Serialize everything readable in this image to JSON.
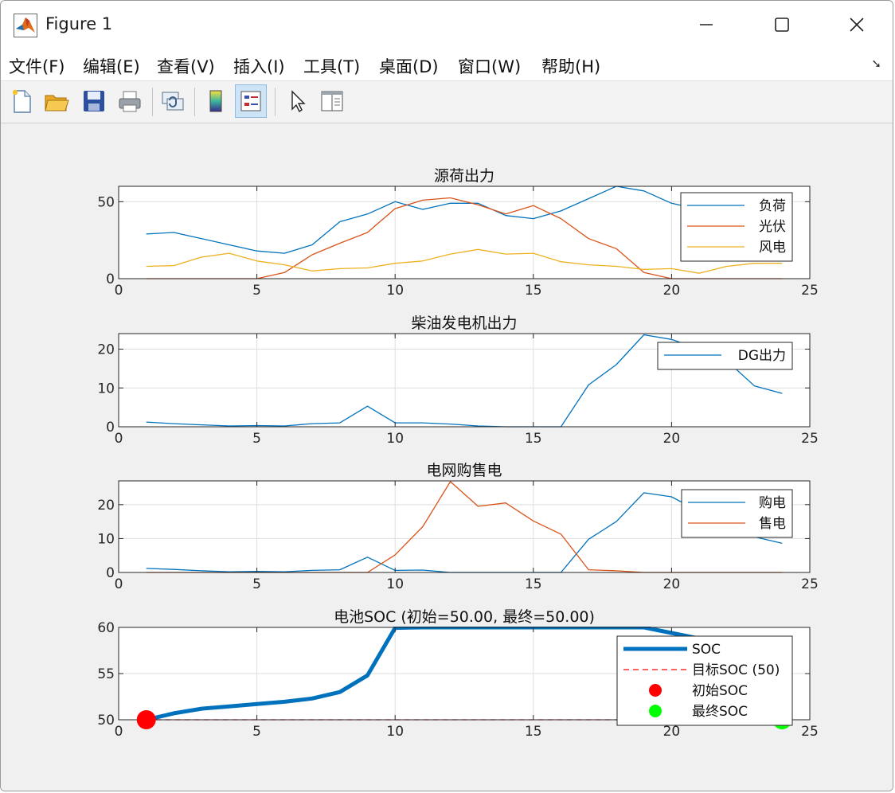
{
  "window": {
    "title": "Figure 1"
  },
  "menu": [
    "文件(F)",
    "编辑(E)",
    "查看(V)",
    "插入(I)",
    "工具(T)",
    "桌面(D)",
    "窗口(W)",
    "帮助(H)"
  ],
  "toolbar_icons": [
    "new-file-icon",
    "open-folder-icon",
    "save-icon",
    "print-icon",
    "link-plot-icon",
    "colorbar-icon",
    "legend-icon",
    "pointer-icon",
    "property-inspector-icon"
  ],
  "colors": {
    "blue": "#0072BD",
    "orange": "#D95319",
    "yellow": "#EDB120",
    "red": "#FF0000",
    "green": "#00FF00"
  },
  "chart_data": [
    {
      "type": "line",
      "title": "源荷出力",
      "xlim": [
        0,
        25
      ],
      "ylim": [
        0,
        60
      ],
      "xticks": [
        0,
        5,
        10,
        15,
        20,
        25
      ],
      "yticks": [
        0,
        50
      ],
      "x": [
        1,
        2,
        3,
        4,
        5,
        6,
        7,
        8,
        9,
        10,
        11,
        12,
        13,
        14,
        15,
        16,
        17,
        18,
        19,
        20,
        21,
        22,
        23,
        24
      ],
      "series": [
        {
          "name": "负荷",
          "color": "#0072BD",
          "values": [
            29,
            30,
            26,
            22,
            18,
            16.5,
            22,
            37,
            42,
            50,
            45,
            49,
            49,
            41,
            39,
            44,
            52,
            60,
            57,
            49,
            45,
            37,
            40,
            40
          ]
        },
        {
          "name": "光伏",
          "color": "#D95319",
          "values": [
            0,
            0,
            0,
            0,
            0,
            4,
            15.5,
            23,
            30,
            45.5,
            51,
            52.5,
            48,
            42,
            47.5,
            39,
            26,
            19.5,
            4,
            0,
            0,
            0,
            0,
            0
          ]
        },
        {
          "name": "风电",
          "color": "#EDB120",
          "values": [
            8,
            8.5,
            14,
            16.5,
            11.5,
            9,
            5,
            6.5,
            7,
            10,
            11.5,
            16,
            19,
            16,
            16.5,
            11,
            9,
            8,
            6,
            6.5,
            3.5,
            8,
            10,
            10
          ]
        }
      ],
      "legend": "top-right",
      "grid": true
    },
    {
      "type": "line",
      "title": "柴油发电机出力",
      "xlim": [
        0,
        25
      ],
      "ylim": [
        0,
        24
      ],
      "xticks": [
        0,
        5,
        10,
        15,
        20,
        25
      ],
      "yticks": [
        0,
        10,
        20
      ],
      "x": [
        1,
        2,
        3,
        4,
        5,
        6,
        7,
        8,
        9,
        10,
        11,
        12,
        13,
        14,
        15,
        16,
        17,
        18,
        19,
        20,
        21,
        22,
        23,
        24
      ],
      "series": [
        {
          "name": "DG出力",
          "color": "#0072BD",
          "values": [
            1.2,
            0.8,
            0.5,
            0.2,
            0.3,
            0.2,
            0.8,
            1,
            5.3,
            1,
            1,
            0.7,
            0.2,
            0,
            0,
            0,
            10.8,
            16,
            23.7,
            22.5,
            20,
            17,
            10.5,
            8.6
          ]
        }
      ],
      "legend": "top-right",
      "grid": true
    },
    {
      "type": "line",
      "title": "电网购售电",
      "xlim": [
        0,
        25
      ],
      "ylim": [
        0,
        27
      ],
      "xticks": [
        0,
        5,
        10,
        15,
        20,
        25
      ],
      "yticks": [
        0,
        10,
        20
      ],
      "x": [
        1,
        2,
        3,
        4,
        5,
        6,
        7,
        8,
        9,
        10,
        11,
        12,
        13,
        14,
        15,
        16,
        17,
        18,
        19,
        20,
        21,
        22,
        23,
        24
      ],
      "series": [
        {
          "name": "购电",
          "color": "#0072BD",
          "values": [
            1.2,
            0.9,
            0.5,
            0.2,
            0.3,
            0.2,
            0.6,
            0.8,
            4.5,
            0.6,
            0.7,
            0,
            0,
            0,
            0,
            0,
            9.8,
            15,
            23.5,
            22.3,
            18,
            14,
            10.5,
            8.6
          ]
        },
        {
          "name": "售电",
          "color": "#D95319",
          "values": [
            0,
            0,
            0,
            0,
            0,
            0,
            0,
            0,
            0,
            5.2,
            13.5,
            26.8,
            19.5,
            20.5,
            15.2,
            11.3,
            0.8,
            0.5,
            0,
            0,
            0,
            0,
            0,
            0
          ]
        }
      ],
      "legend": "top-right",
      "grid": true
    },
    {
      "type": "line",
      "title": "电池SOC (初始=50.00, 最终=50.00)",
      "xlim": [
        0,
        25
      ],
      "ylim": [
        50,
        60
      ],
      "xticks": [
        0,
        5,
        10,
        15,
        20,
        25
      ],
      "yticks": [
        50,
        55,
        60
      ],
      "x": [
        1,
        2,
        3,
        4,
        5,
        6,
        7,
        8,
        9,
        10,
        11,
        12,
        13,
        14,
        15,
        16,
        17,
        18,
        19,
        20,
        21,
        22,
        23,
        24
      ],
      "series": [
        {
          "name": "SOC",
          "color": "#0072BD",
          "values": [
            50,
            50.7,
            51.2,
            51.45,
            51.7,
            51.95,
            52.3,
            53,
            54.8,
            59.95,
            60,
            60,
            60,
            60,
            60,
            60,
            60,
            60,
            60,
            59.4,
            58.8,
            55,
            53,
            50
          ]
        },
        {
          "name": "目标SOC (50)",
          "color": "#FF0000",
          "dashed": true,
          "values": [
            50,
            50,
            50,
            50,
            50,
            50,
            50,
            50,
            50,
            50,
            50,
            50,
            50,
            50,
            50,
            50,
            50,
            50,
            50,
            50,
            50,
            50,
            50,
            50
          ]
        }
      ],
      "markers": [
        {
          "name": "初始SOC",
          "color": "#FF0000",
          "x": 1,
          "y": 50
        },
        {
          "name": "最终SOC",
          "color": "#00FF00",
          "x": 24,
          "y": 50
        }
      ],
      "legend": "top-right",
      "grid": true
    }
  ]
}
